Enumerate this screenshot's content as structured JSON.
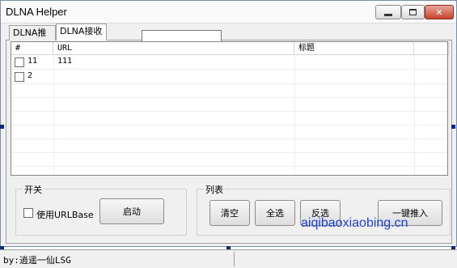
{
  "window": {
    "title": "DLNA Helper"
  },
  "tabs": [
    {
      "label": "DLNA推送",
      "active": false
    },
    {
      "label": "DLNA接收",
      "active": true
    }
  ],
  "list": {
    "columns": [
      "#",
      "URL",
      "标题",
      ""
    ],
    "rows": [
      {
        "num": "11",
        "url": "111",
        "title": "",
        "checked": false
      },
      {
        "num": "2",
        "url": "",
        "title": "",
        "checked": false
      }
    ]
  },
  "switch_group": {
    "legend": "开关",
    "use_urlbase_label": "使用URLBase",
    "use_urlbase_checked": false,
    "start_button": "启动"
  },
  "list_group": {
    "legend": "列表",
    "clear_button": "清空",
    "select_all_button": "全选",
    "invert_button": "反选",
    "push_all_button": "一键推入"
  },
  "status": {
    "text": "by:逍遥一仙LSG"
  },
  "watermark": "aiqibaoxiaobing.cn",
  "colors": {
    "watermark": "#1a3fd6",
    "title_close": "#c7432f"
  }
}
